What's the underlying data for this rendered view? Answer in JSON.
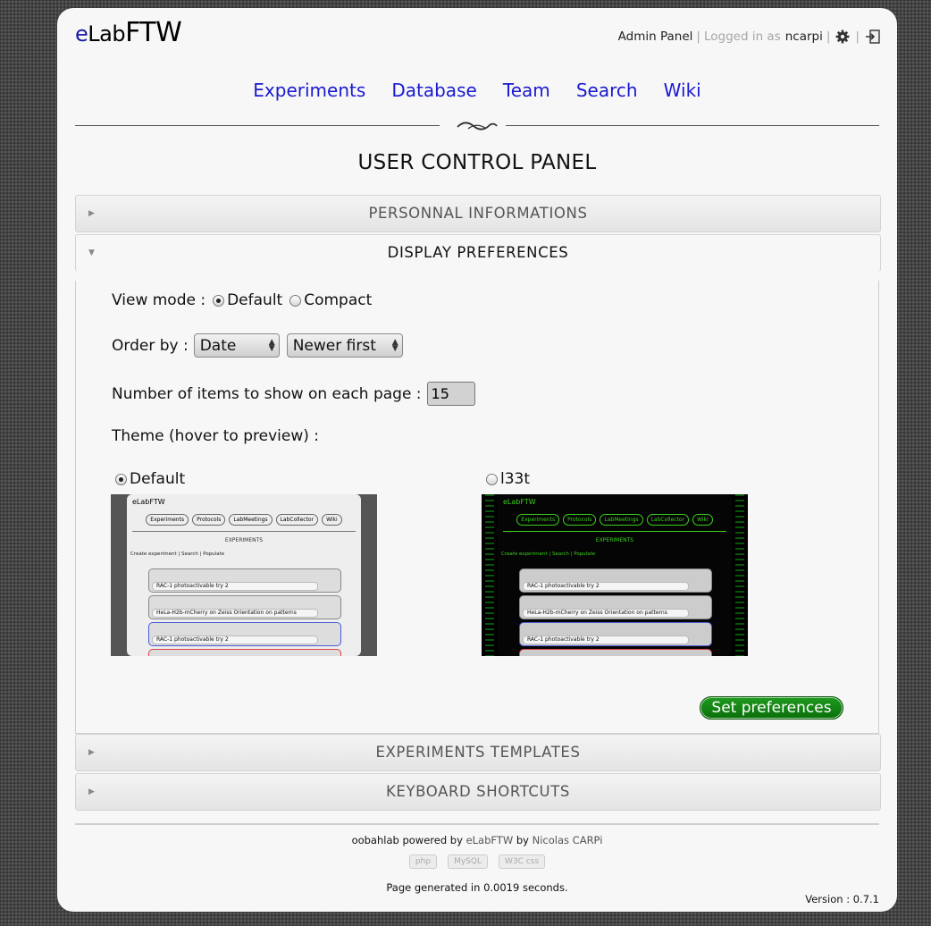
{
  "header": {
    "logo_e": "e",
    "logo_lab": "Lab",
    "logo_ftw": "FTW",
    "admin_panel": "Admin Panel",
    "logged_in_as": "Logged in as",
    "username": "ncarpi",
    "separator": "|"
  },
  "nav": [
    "Experiments",
    "Database",
    "Team",
    "Search",
    "Wiki"
  ],
  "page_title": "USER CONTROL PANEL",
  "sections": {
    "personal": "PERSONNAL INFORMATIONS",
    "display": "DISPLAY PREFERENCES",
    "templates": "EXPERIMENTS TEMPLATES",
    "shortcuts": "KEYBOARD SHORTCUTS"
  },
  "display": {
    "view_mode_label": "View mode :",
    "view_default": "Default",
    "view_compact": "Compact",
    "view_selected": "Default",
    "order_by_label": "Order by :",
    "order_by_value": "Date",
    "sort_value": "Newer first",
    "items_label": "Number of items to show on each page :",
    "items_value": "15",
    "theme_label": "Theme (hover to preview) :",
    "theme_default": "Default",
    "theme_l33t": "l33t",
    "theme_selected": "Default",
    "submit": "Set preferences"
  },
  "preview": {
    "logo": "eLabFTW",
    "nav": [
      "Experiments",
      "Protocols",
      "LabMeetings",
      "LabCollector",
      "Wiki"
    ],
    "title": "EXPERIMENTS",
    "toolbar": "Create experiment | Search | Populate",
    "items": [
      "RAC-1 photoactivable try 2",
      "HeLa-H2b-mCherry on Zeiss Orientation on patterns",
      "RAC-1 photoactivable try 2"
    ]
  },
  "footer": {
    "line1_a": "oobahlab powered by ",
    "line1_b": "eLabFTW",
    "line1_c": " by ",
    "line1_d": "Nicolas CARPi",
    "badges": [
      "php",
      "MySQL",
      "W3C css"
    ],
    "generated": "Page generated in 0.0019 seconds.",
    "version": "Version : 0.7.1"
  },
  "colors": {
    "link": "#1a1ad0",
    "button": "#118211",
    "l33t_green": "#39d11a"
  }
}
